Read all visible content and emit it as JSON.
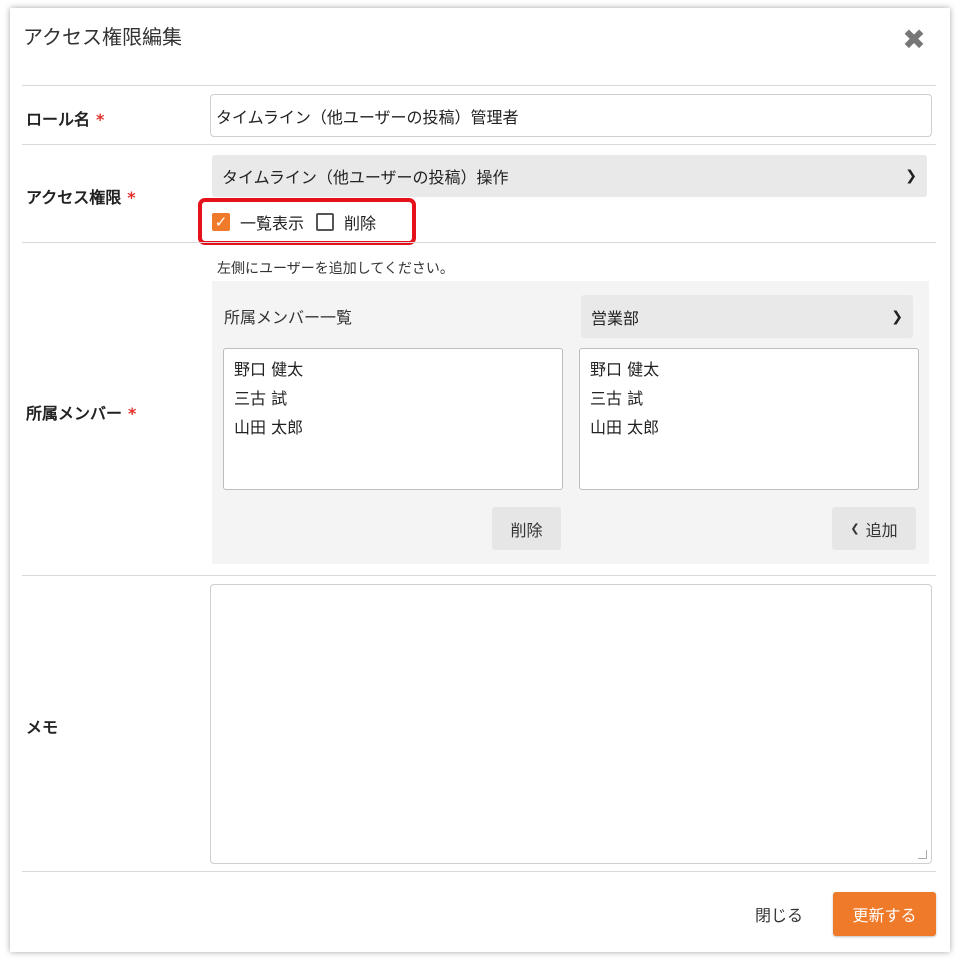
{
  "dialog": {
    "title": "アクセス権限編集"
  },
  "form": {
    "role_name": {
      "label": "ロール名",
      "required": "*",
      "value": "タイムライン（他ユーザーの投稿）管理者"
    },
    "access": {
      "label": "アクセス権限",
      "required": "*",
      "selected": "タイムライン（他ユーザーの投稿）操作",
      "checkboxes": [
        {
          "label": "一覧表示",
          "checked": true
        },
        {
          "label": "削除",
          "checked": false
        }
      ]
    },
    "members": {
      "label": "所属メンバー",
      "required": "*",
      "hint": "左側にユーザーを追加してください。",
      "list_title": "所属メンバー一覧",
      "department_selected": "営業部",
      "assigned": [
        "野口 健太",
        "三古 試",
        "山田 太郎"
      ],
      "available": [
        "野口 健太",
        "三古 試",
        "山田 太郎"
      ],
      "remove_label": "削除",
      "add_label": "追加"
    },
    "memo": {
      "label": "メモ",
      "value": ""
    }
  },
  "footer": {
    "close_label": "閉じる",
    "submit_label": "更新する"
  },
  "colors": {
    "accent": "#ef7a2a",
    "required": "#e0322a",
    "highlight_border": "#e5111b"
  }
}
